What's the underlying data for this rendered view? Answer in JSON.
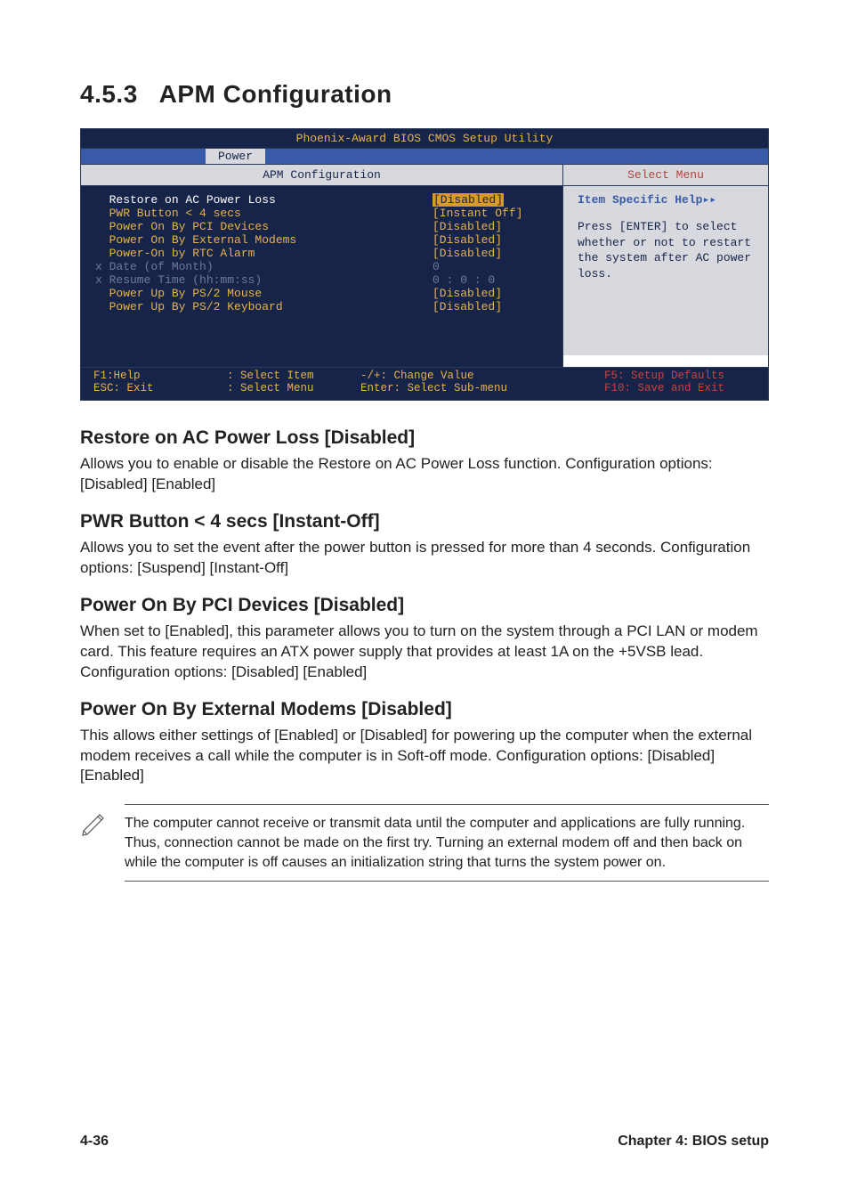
{
  "section_number": "4.5.3",
  "section_title": "APM Configuration",
  "bios": {
    "title": "Phoenix-Award BIOS CMOS Setup Utility",
    "tab": "Power",
    "left_header": "APM Configuration",
    "right_header": "Select Menu",
    "rows": [
      {
        "label": "Restore on AC Power Loss",
        "value": "[Disabled]",
        "highlight": true
      },
      {
        "label": "PWR Button < 4 secs",
        "value": "[Instant Off]"
      },
      {
        "label": "Power On By PCI Devices",
        "value": "[Disabled]"
      },
      {
        "label": "Power On By External Modems",
        "value": "[Disabled]"
      },
      {
        "label": "Power-On by RTC Alarm",
        "value": "[Disabled]"
      },
      {
        "label": "x Date (of Month)",
        "value": "  0",
        "grey": true
      },
      {
        "label": "x Resume Time (hh:mm:ss)",
        "value": "0 : 0 : 0",
        "grey": true,
        "valshift": true
      },
      {
        "label": "Power Up By PS/2 Mouse",
        "value": "[Disabled]"
      },
      {
        "label": "Power Up By PS/2 Keyboard",
        "value": "[Disabled]"
      }
    ],
    "help_title": "Item Specific Help",
    "help_body": "Press [ENTER] to select whether or not to restart the system after AC power loss.",
    "footer": {
      "c1a": "F1:Help",
      "c1b": "ESC: Exit",
      "c2a": ": Select Item",
      "c2b": ": Select Menu",
      "c3a": "-/+: Change Value",
      "c3b": "Enter: Select Sub-menu",
      "c4a": "F5: Setup Defaults",
      "c4b": "F10: Save and Exit"
    }
  },
  "sections": [
    {
      "heading": "Restore on AC Power Loss [Disabled]",
      "body": "Allows you to enable or disable the Restore on AC Power Loss function. Configuration options: [Disabled] [Enabled]"
    },
    {
      "heading": "PWR Button < 4 secs [Instant-Off]",
      "body": "Allows you to set the event after the power button is pressed for more than 4 seconds. Configuration options: [Suspend] [Instant-Off]"
    },
    {
      "heading": "Power On By PCI Devices [Disabled]",
      "body": "When set to [Enabled], this parameter allows you to turn on the system through a PCI LAN or modem card. This feature requires an ATX power supply that provides at least 1A on the +5VSB lead. Configuration options: [Disabled] [Enabled]"
    },
    {
      "heading": "Power On By External Modems [Disabled]",
      "body": "This allows either settings of [Enabled] or [Disabled] for powering up the computer when the external modem receives a call while the computer is in Soft-off mode. Configuration options: [Disabled] [Enabled]"
    }
  ],
  "note": "The computer cannot receive or transmit data until the computer and applications are fully running. Thus, connection cannot be made on the first try. Turning an external modem off and then back on while the computer is off causes an initialization string that turns the system power on.",
  "footer_left": "4-36",
  "footer_right": "Chapter 4: BIOS setup"
}
